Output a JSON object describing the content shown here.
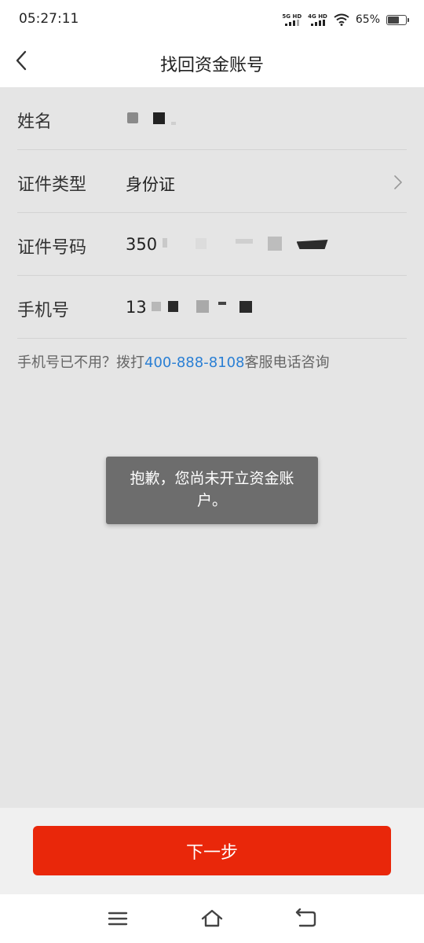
{
  "status_bar": {
    "time": "05:27:11",
    "network1_label": "5G HD",
    "network2_label": "4G HD",
    "battery_percent": "65%",
    "battery_level": 0.65
  },
  "header": {
    "title": "找回资金账号"
  },
  "form": {
    "name": {
      "label": "姓名",
      "value": ""
    },
    "id_type": {
      "label": "证件类型",
      "value": "身份证"
    },
    "id_number": {
      "label": "证件号码",
      "value": "350"
    },
    "phone": {
      "label": "手机号",
      "value": "13"
    }
  },
  "help": {
    "prefix": "手机号已不用？拨打",
    "phone": "400-888-8108",
    "suffix": "客服电话咨询"
  },
  "toast": {
    "message": "抱歉，您尚未开立资金账户。"
  },
  "footer": {
    "next_label": "下一步"
  },
  "colors": {
    "accent": "#e9270a",
    "link": "#2a7fd4",
    "background": "#e5e5e5"
  },
  "icons": {
    "back": "chevron-left-icon",
    "row_arrow": "chevron-right-icon",
    "menu": "menu-icon",
    "home": "home-icon",
    "return": "return-icon"
  }
}
